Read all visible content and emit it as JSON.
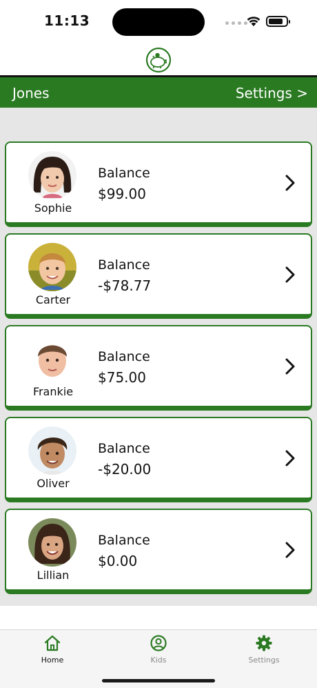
{
  "status_bar": {
    "time": "11:13"
  },
  "header": {
    "family_name": "Jones",
    "settings_link": "Settings >"
  },
  "kids": [
    {
      "name": "Sophie",
      "balance_label": "Balance",
      "balance": "$99.00"
    },
    {
      "name": "Carter",
      "balance_label": "Balance",
      "balance": "-$78.77"
    },
    {
      "name": "Frankie",
      "balance_label": "Balance",
      "balance": "$75.00"
    },
    {
      "name": "Oliver",
      "balance_label": "Balance",
      "balance": "-$20.00"
    },
    {
      "name": "Lillian",
      "balance_label": "Balance",
      "balance": "$0.00"
    }
  ],
  "tab_bar": {
    "tabs": [
      {
        "label": "Home",
        "icon": "home-icon",
        "active": true
      },
      {
        "label": "Kids",
        "icon": "user-circle-icon",
        "active": false
      },
      {
        "label": "Settings",
        "icon": "gear-icon",
        "active": false
      }
    ]
  },
  "colors": {
    "brand_green": "#2a7a22",
    "background_gray": "#e6e6e6",
    "inactive_tab": "#8a8a8a"
  }
}
